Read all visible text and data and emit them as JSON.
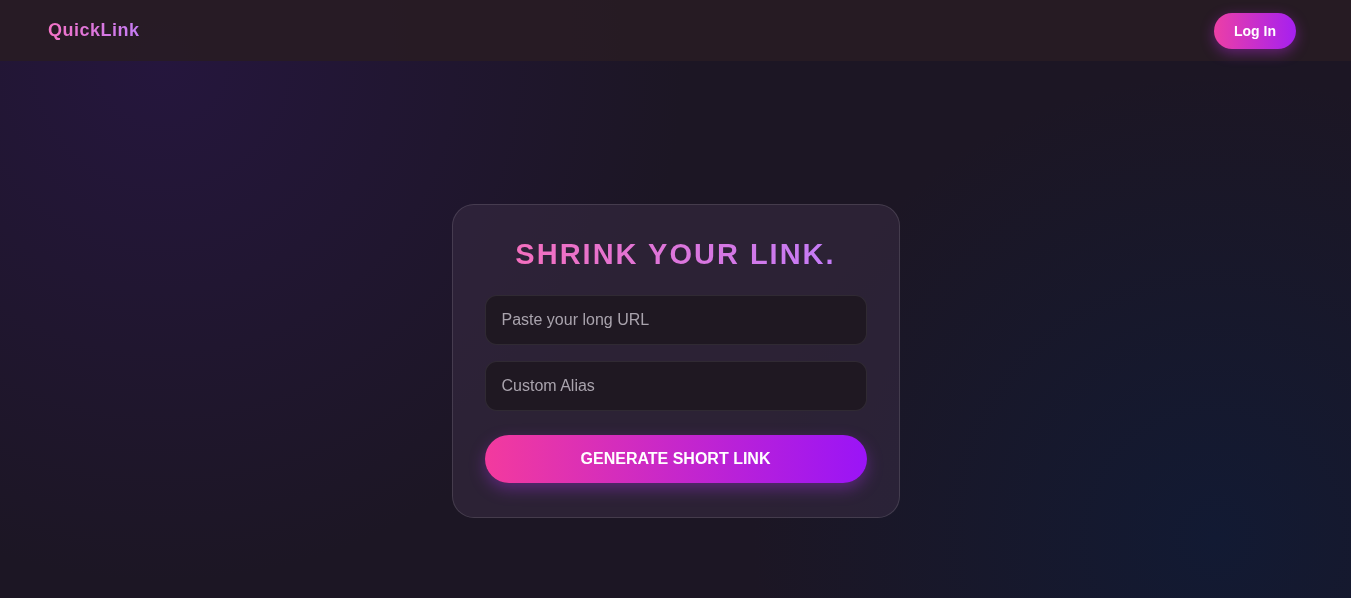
{
  "header": {
    "logo": "QuickLink",
    "login_button": "Log In"
  },
  "card": {
    "title": "SHRINK YOUR LINK.",
    "fields": [
      {
        "placeholder": "Paste your long URL"
      },
      {
        "placeholder": "Custom Alias"
      }
    ],
    "submit_button": "GENERATE SHORT LINK"
  }
}
